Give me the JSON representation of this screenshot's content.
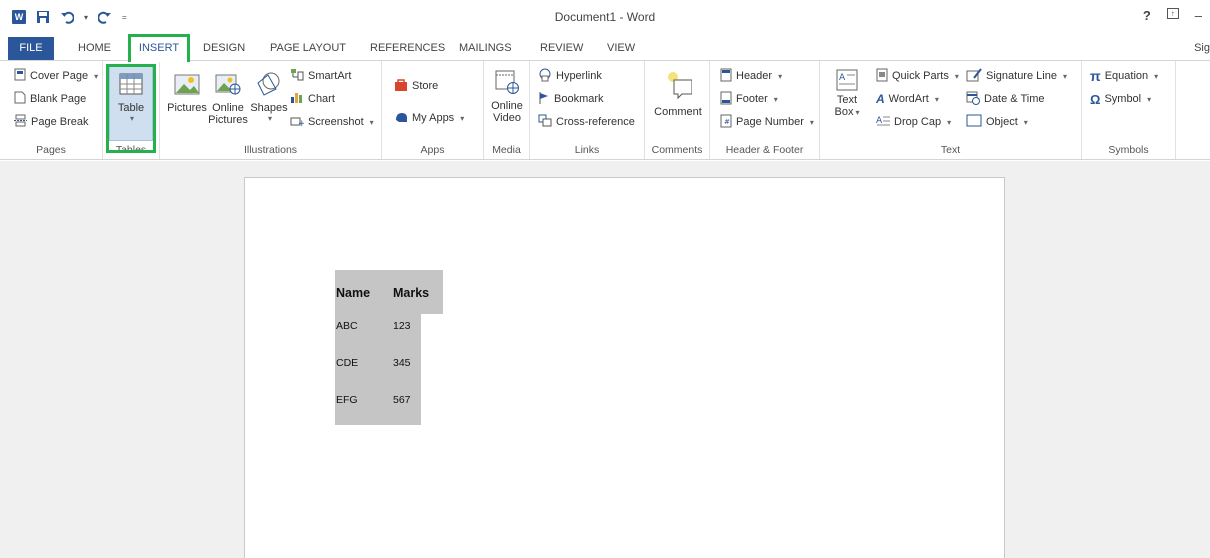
{
  "window": {
    "title": "Document1 - Word",
    "help": "?",
    "minimize": "–"
  },
  "tabs": [
    "FILE",
    "HOME",
    "INSERT",
    "DESIGN",
    "PAGE LAYOUT",
    "REFERENCES",
    "MAILINGS",
    "REVIEW",
    "VIEW"
  ],
  "tab_truncated": "Sig",
  "ribbon": {
    "pages": {
      "label": "Pages",
      "cover_page": "Cover Page",
      "blank_page": "Blank Page",
      "page_break": "Page Break"
    },
    "tables": {
      "label": "Tables",
      "table": "Table"
    },
    "illustrations": {
      "label": "Illustrations",
      "pictures": "Pictures",
      "online_pictures_1": "Online",
      "online_pictures_2": "Pictures",
      "shapes": "Shapes",
      "smartart": "SmartArt",
      "chart": "Chart",
      "screenshot": "Screenshot"
    },
    "apps": {
      "label": "Apps",
      "store": "Store",
      "my_apps": "My Apps"
    },
    "media": {
      "label": "Media",
      "online_video_1": "Online",
      "online_video_2": "Video"
    },
    "links": {
      "label": "Links",
      "hyperlink": "Hyperlink",
      "bookmark": "Bookmark",
      "cross_reference": "Cross-reference"
    },
    "comments": {
      "label": "Comments",
      "comment": "Comment"
    },
    "header_footer": {
      "label": "Header & Footer",
      "header": "Header",
      "footer": "Footer",
      "page_number": "Page Number"
    },
    "text": {
      "label": "Text",
      "text_box_1": "Text",
      "text_box_2": "Box",
      "quick_parts": "Quick Parts",
      "wordart": "WordArt",
      "drop_cap": "Drop Cap",
      "signature_line": "Signature Line",
      "date_time": "Date & Time",
      "object": "Object"
    },
    "symbols": {
      "label": "Symbols",
      "equation": "Equation",
      "symbol": "Symbol"
    }
  },
  "document": {
    "table": {
      "headers": [
        "Name",
        "Marks"
      ],
      "rows": [
        [
          "ABC",
          "123"
        ],
        [
          "CDE",
          "345"
        ],
        [
          "EFG",
          "567"
        ]
      ]
    }
  },
  "colors": {
    "accent": "#2b579a",
    "highlight": "#24b04a",
    "table_shading": "#c5c5c5"
  }
}
